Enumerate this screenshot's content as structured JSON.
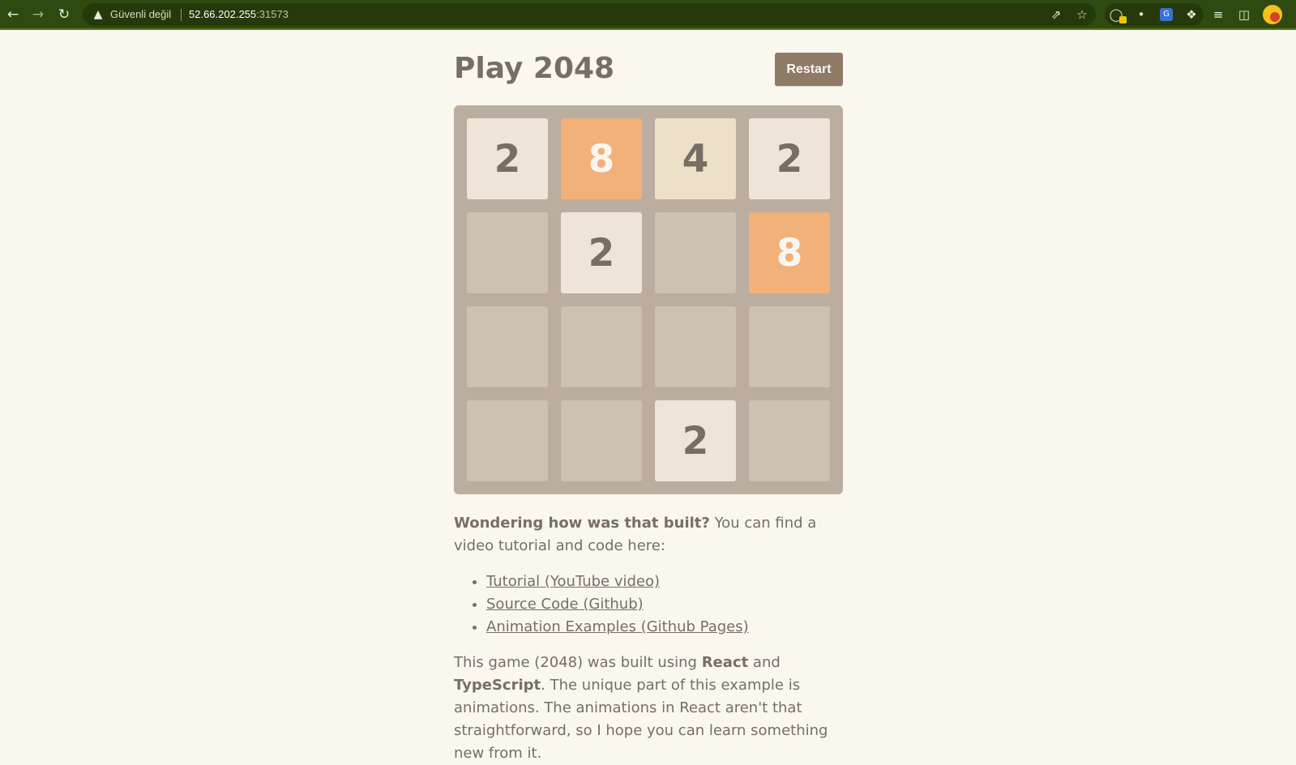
{
  "browser": {
    "security_label": "Güvenli değil",
    "url_host": "52.66.202.255",
    "url_port": ":31573",
    "icons": [
      "back-icon",
      "forward-icon",
      "reload-icon",
      "warning-icon",
      "share-icon",
      "star-icon",
      "extension-icon",
      "puzzle-icon",
      "reading-list-icon",
      "side-panel-icon",
      "avatar"
    ]
  },
  "page": {
    "title": "Play 2048",
    "restart_label": "Restart"
  },
  "board": {
    "rows": [
      [
        "2",
        "8",
        "4",
        "2"
      ],
      [
        "",
        "2",
        "",
        "8"
      ],
      [
        "",
        "",
        "",
        ""
      ],
      [
        "",
        "",
        "2",
        ""
      ]
    ]
  },
  "info": {
    "question_bold": "Wondering how was that built?",
    "question_rest": " You can find a video tutorial and code here:",
    "links": [
      "Tutorial (YouTube video)",
      "Source Code (Github)",
      "Animation Examples (Github Pages)"
    ],
    "para_1": "This game (2048) was built using ",
    "react": "React",
    "and": " and ",
    "typescript": "TypeScript",
    "para_2": ". The unique part of this example is animations. The animations in React aren't that straightforward, so I hope you can learn something new from it."
  },
  "colors": {
    "tile_2": "#eee4da",
    "tile_4": "#ede0c8",
    "tile_8": "#f2b179",
    "board": "#bbada0",
    "empty": "#cdc1b4",
    "text": "#776e65",
    "chrome": "#2f4a10"
  }
}
